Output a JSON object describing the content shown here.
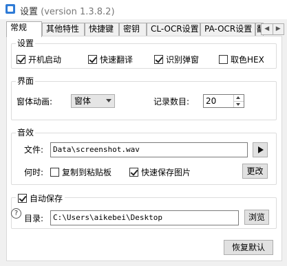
{
  "window": {
    "title": "设置",
    "version": "(version 1.3.8.2)"
  },
  "tabs": [
    {
      "label": "常规",
      "active": true
    },
    {
      "label": "其他特性",
      "active": false
    },
    {
      "label": "快捷键",
      "active": false
    },
    {
      "label": "密钥",
      "active": false
    },
    {
      "label": "CL-OCR设置",
      "active": false
    },
    {
      "label": "PA-OCR设置",
      "active": false
    },
    {
      "label": "翻",
      "active": false
    }
  ],
  "tab_scroll": {
    "left": "◀",
    "right": "▶"
  },
  "settings_group": {
    "title": "设置",
    "options": [
      {
        "label": "开机启动",
        "checked": true
      },
      {
        "label": "快速翻译",
        "checked": true
      },
      {
        "label": "识别弹窗",
        "checked": true
      },
      {
        "label": "取色HEX",
        "checked": false
      }
    ]
  },
  "interface_group": {
    "title": "界面",
    "animation_label": "窗体动画:",
    "animation_value": "窗体",
    "records_label": "记录数目:",
    "records_value": "20"
  },
  "sound_group": {
    "title": "音效",
    "file_label": "文件:",
    "file_value": "Data\\screenshot.wav",
    "when_label": "何时:",
    "copy_label": "复制到粘贴板",
    "copy_checked": false,
    "save_label": "快速保存图片",
    "save_checked": true,
    "change_button": "更改"
  },
  "autosave_group": {
    "title": "自动保存",
    "checked": true,
    "dir_label": "目录:",
    "dir_value": "C:\\Users\\aikebei\\Desktop",
    "browse_button": "浏览"
  },
  "footer": {
    "help": "?",
    "restore_button": "恢复默认"
  }
}
